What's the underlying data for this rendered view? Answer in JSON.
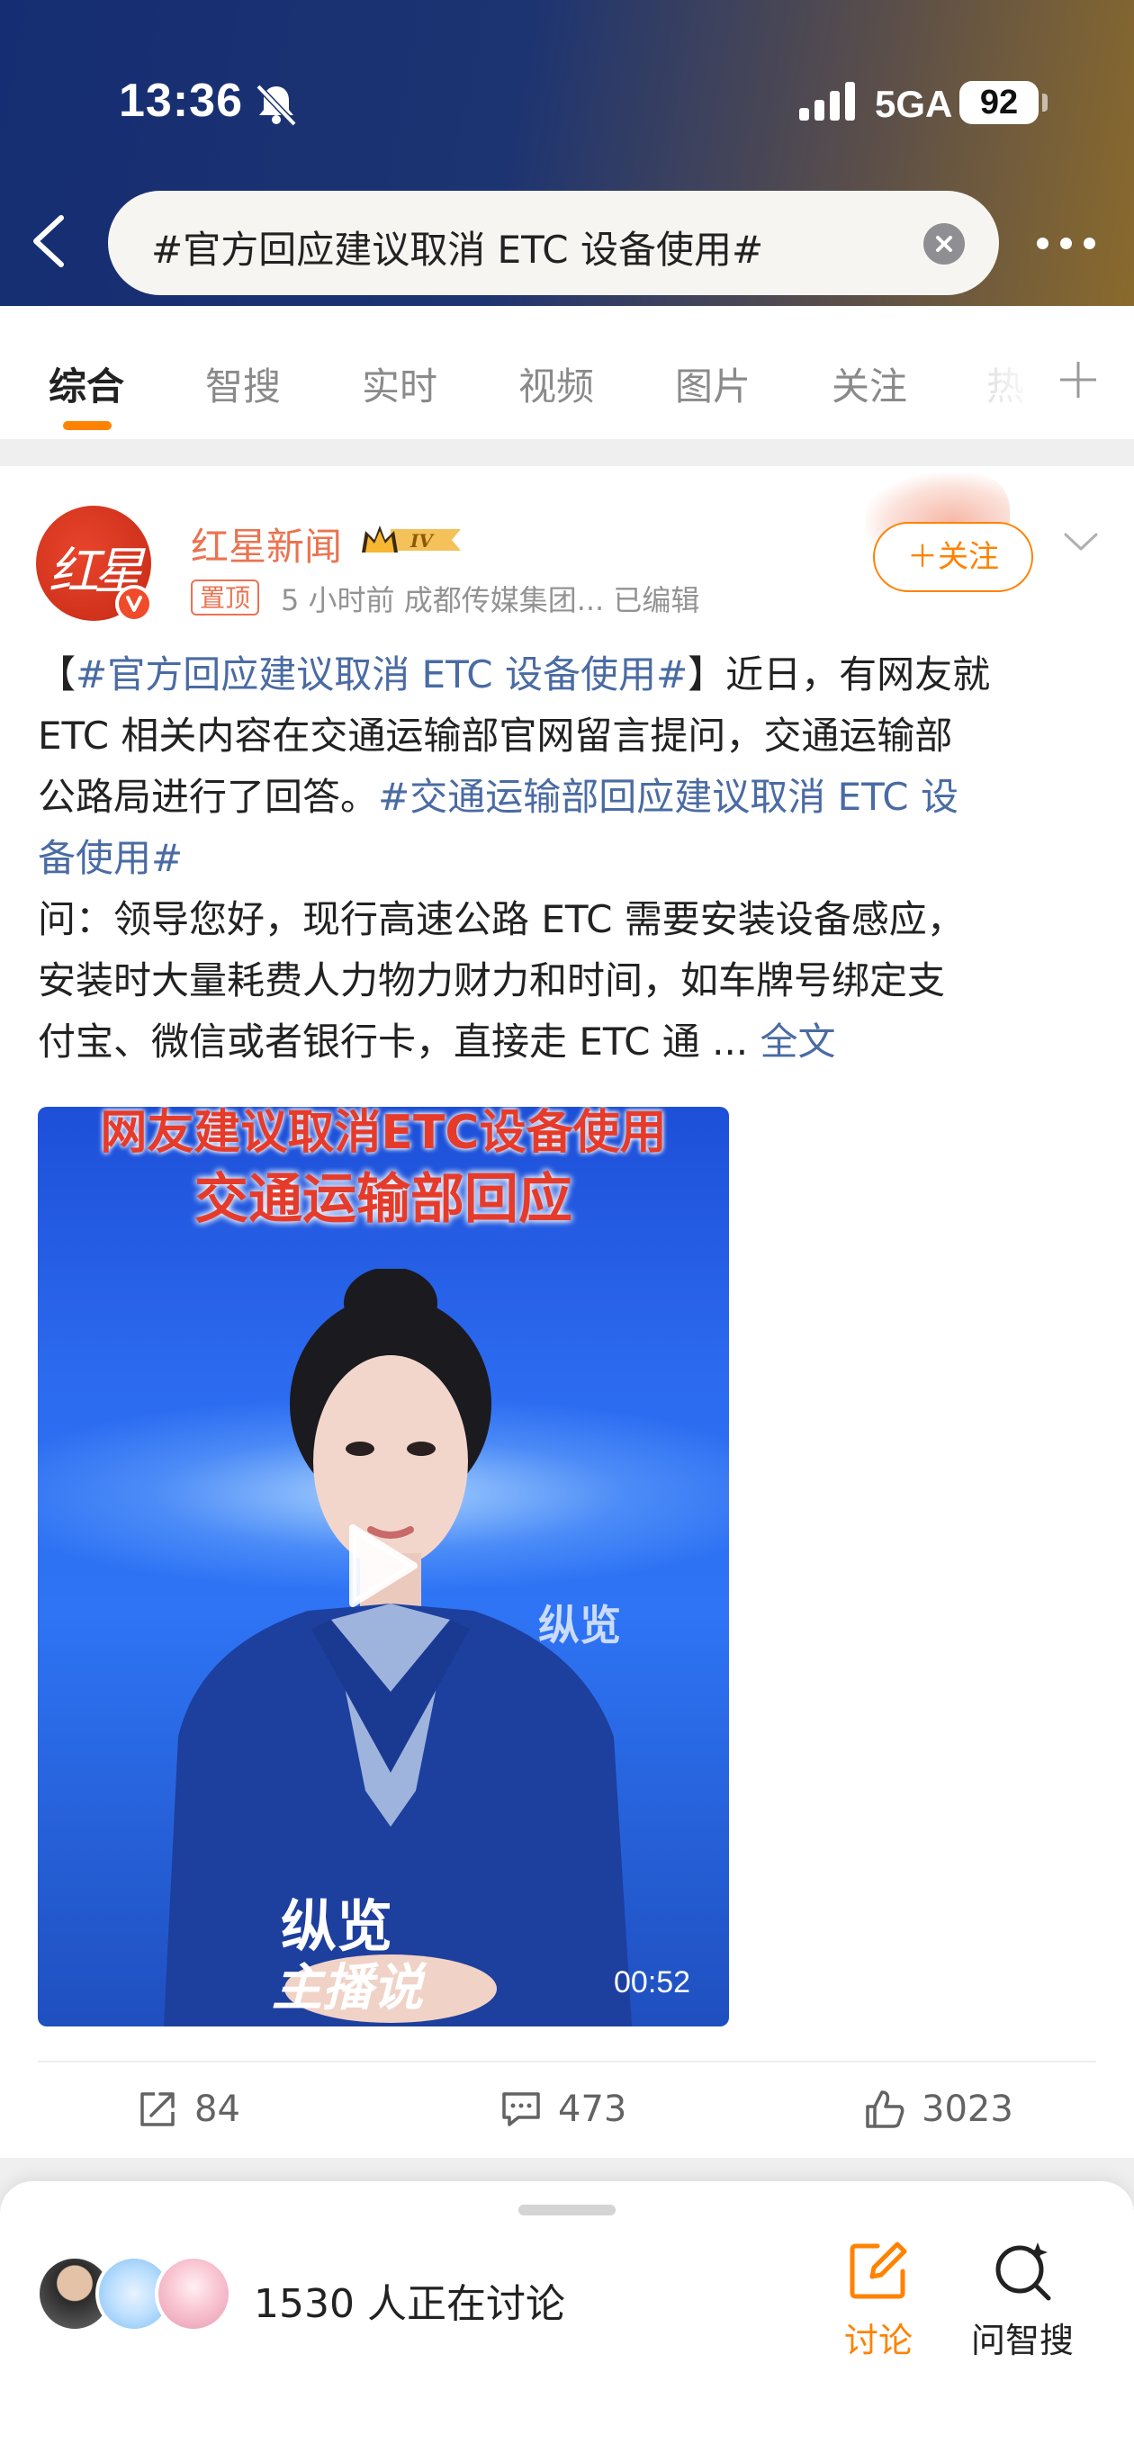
{
  "status_bar": {
    "time": "13:36",
    "network": "5GA",
    "battery": "92"
  },
  "search": {
    "query": "#官方回应建议取消 ETC 设备使用#"
  },
  "tabs": [
    {
      "label": "综合"
    },
    {
      "label": "智搜"
    },
    {
      "label": "实时"
    },
    {
      "label": "视频"
    },
    {
      "label": "图片"
    },
    {
      "label": "关注"
    },
    {
      "label": "热"
    }
  ],
  "post": {
    "avatar_text": "红星",
    "author": "红星新闻",
    "level_badge": "IV",
    "pin_label": "置顶",
    "meta": "5 小时前   成都传媒集团...   已编辑",
    "follow_label": "＋关注",
    "text": {
      "l1_pre": "【",
      "l1_tag": "#官方回应建议取消 ETC 设备使用#",
      "l1_post": "】近日，有网友就",
      "l2": "ETC 相关内容在交通运输部官网留言提问，交通运输部",
      "l3_pre": "公路局进行了回答。",
      "l3_tag": "#交通运输部回应建议取消 ETC 设",
      "l4_tag": "备使用#",
      "l5": "问：领导您好，现行高速公路 ETC 需要安装设备感应，",
      "l6": "安装时大量耗费人力物力财力和时间，如车牌号绑定支",
      "l7": "付宝、微信或者银行卡，直接走 ETC 通  ...",
      "more": "全文"
    },
    "video": {
      "caption_top": "网友建议取消ETC设备使用",
      "caption_main": "交通运输部回应",
      "watermark_corner": "纵览",
      "watermark_brand": "纵览",
      "watermark_sub": "主播说",
      "duration": "00:52"
    },
    "actions": {
      "reposts": "84",
      "comments": "473",
      "likes": "3023"
    }
  },
  "bottom_sheet": {
    "participants": "1530 人正在讨论",
    "discuss_label": "讨论",
    "ask_label": "问智搜"
  },
  "colors": {
    "accent": "#ff8200",
    "link": "#4a6ba3",
    "author": "#eb7350"
  }
}
